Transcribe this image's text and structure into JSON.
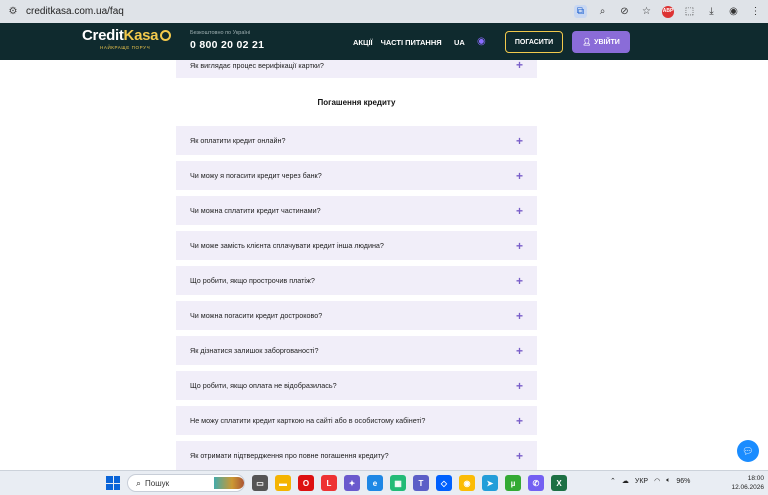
{
  "browser": {
    "url": "creditkasa.com.ua/faq"
  },
  "header": {
    "logo_credit": "Credit",
    "logo_kasa": "Kasa",
    "logo_tagline": "НАЙКРАЩЕ ПОРУЧ",
    "phone_caption": "Безкоштовно по Україні",
    "phone": "0 800 20 02 21",
    "nav": [
      "АКЦІЇ",
      "ЧАСТІ ПИТАННЯ"
    ],
    "lang": "UA",
    "pay_button": "ПОГАСИТИ",
    "login_button": "УВІЙТИ"
  },
  "faq": {
    "top_item": "Як виглядає процес верифікації картки?",
    "section_title": "Погашення кредиту",
    "items": [
      "Як оплатити кредит онлайн?",
      "Чи можу я погасити кредит через банк?",
      "Чи можна сплатити кредит частинами?",
      "Чи може замість клієнта сплачувати кредит інша людина?",
      "Що робити, якщо прострочив платіж?",
      "Чи можна погасити кредит достроково?",
      "Як дізнатися залишок заборгованості?",
      "Що робити, якщо оплата не відобразилась?",
      "Не можу сплатити кредит карткою на сайті або в особистому кабінеті?",
      "Як отримати підтвердження про повне погашення кредиту?"
    ]
  },
  "taskbar": {
    "search_placeholder": "Пошук",
    "lang": "УКР",
    "battery": "96%",
    "time": "18:00",
    "date": "12.06.2026"
  },
  "colors": {
    "header_bg": "#0f2a2e",
    "accent_yellow": "#f2c94c",
    "accent_purple": "#8a6cd8",
    "faq_bg": "#f1eef9"
  }
}
